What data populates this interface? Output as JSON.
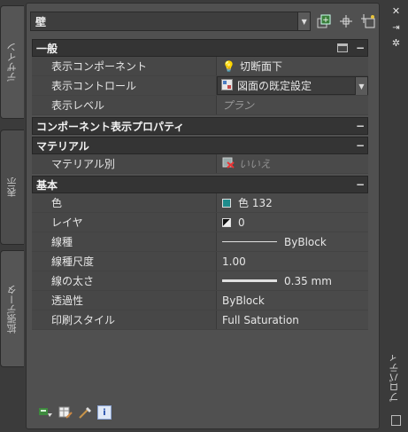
{
  "left_tabs": [
    "デザイン",
    "表示",
    "拡張データ"
  ],
  "toolbar": {
    "object_type": "壁",
    "quick_select_icon": "quick-select-icon",
    "select_objects_icon": "select-objects-icon",
    "toggle_pickadd_icon": "pickadd-icon"
  },
  "sections": {
    "general": {
      "title": "一般",
      "rows": [
        {
          "key": "表示コンポーネント",
          "value": "切断面下"
        },
        {
          "key": "表示コントロール",
          "value": "図面の既定設定"
        },
        {
          "key": "表示レベル",
          "value": "プラン"
        }
      ]
    },
    "component_props": {
      "title": "コンポーネント表示プロパティ"
    },
    "material": {
      "title": "マテリアル",
      "rows": [
        {
          "key": "マテリアル別",
          "value": "いいえ"
        }
      ]
    },
    "basic": {
      "title": "基本",
      "rows": [
        {
          "key": "色",
          "value": "色 132"
        },
        {
          "key": "レイヤ",
          "value": "0"
        },
        {
          "key": "線種",
          "value": "ByBlock"
        },
        {
          "key": "線種尺度",
          "value": "1.00"
        },
        {
          "key": "線の太さ",
          "value": "0.35 mm"
        },
        {
          "key": "透過性",
          "value": "ByBlock"
        },
        {
          "key": "印刷スタイル",
          "value": "Full Saturation"
        }
      ]
    }
  },
  "colors": {
    "color132": "#1f8c8c"
  },
  "right_strip": {
    "title": "プロパティ"
  }
}
